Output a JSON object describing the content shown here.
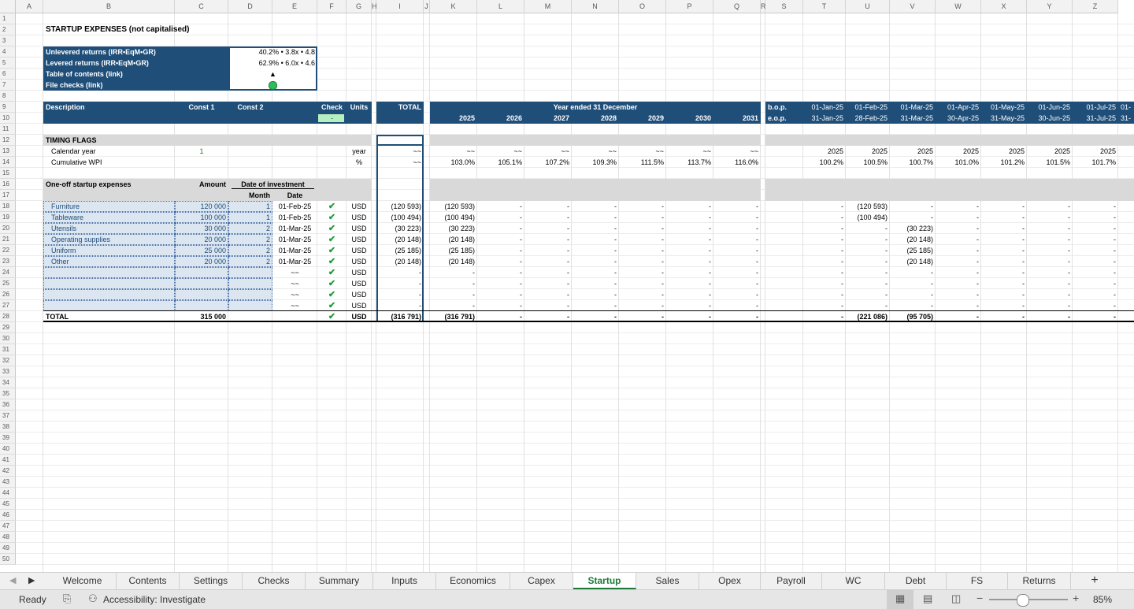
{
  "columns": [
    "A",
    "B",
    "C",
    "D",
    "E",
    "F",
    "G",
    "H",
    "I",
    "J",
    "K",
    "L",
    "M",
    "N",
    "O",
    "P",
    "Q",
    "R",
    "S",
    "T",
    "U",
    "V",
    "W",
    "X",
    "Y",
    "Z"
  ],
  "rows": [
    "1",
    "2",
    "3",
    "4",
    "5",
    "6",
    "7",
    "8",
    "9",
    "10",
    "11",
    "12",
    "13",
    "14",
    "15",
    "16",
    "17",
    "18",
    "19",
    "20",
    "21",
    "22",
    "23",
    "24",
    "25",
    "26",
    "27",
    "28",
    "29",
    "30",
    "31",
    "32",
    "33",
    "34",
    "35",
    "36",
    "37",
    "38",
    "39",
    "40",
    "41",
    "42",
    "43",
    "44",
    "45",
    "46",
    "47",
    "48",
    "49",
    "50"
  ],
  "title": "STARTUP EXPENSES (not capitalised)",
  "summary": {
    "unlevered_label": "Unlevered returns (IRR•EqM•GR)",
    "unlevered_value": "40.2% • 3.8x • 4.8",
    "levered_label": "Levered returns (IRR•EqM•GR)",
    "levered_value": "62.9% • 6.0x • 4.6",
    "toc_label": "Table of contents (link)",
    "toc_value": "▲",
    "checks_label": "File checks (link)"
  },
  "header": {
    "description": "Description",
    "const1": "Const 1",
    "const2": "Const 2",
    "check": "Check",
    "check_value": "-",
    "units": "Units",
    "total": "TOTAL",
    "year_ended": "Year ended 31 December",
    "years": [
      "2025",
      "2026",
      "2027",
      "2028",
      "2029",
      "2030",
      "2031"
    ],
    "bop": "b.o.p.",
    "eop": "e.o.p.",
    "month_starts": [
      "01-Jan-25",
      "01-Feb-25",
      "01-Mar-25",
      "01-Apr-25",
      "01-May-25",
      "01-Jun-25",
      "01-Jul-25",
      "01-"
    ],
    "month_ends": [
      "31-Jan-25",
      "28-Feb-25",
      "31-Mar-25",
      "30-Apr-25",
      "31-May-25",
      "30-Jun-25",
      "31-Jul-25",
      "31-"
    ]
  },
  "timing": {
    "section": "TIMING FLAGS",
    "calendar_label": "Calendar year",
    "calendar_const": "1",
    "calendar_unit": "year",
    "calendar_total": "~~",
    "calendar_annual": [
      "~~",
      "~~",
      "~~",
      "~~",
      "~~",
      "~~",
      "~~"
    ],
    "calendar_monthly": [
      "2025",
      "2025",
      "2025",
      "2025",
      "2025",
      "2025",
      "2025"
    ],
    "wpi_label": "Cumulative WPI",
    "wpi_unit": "%",
    "wpi_total": "~~",
    "wpi_annual": [
      "103.0%",
      "105.1%",
      "107.2%",
      "109.3%",
      "111.5%",
      "113.7%",
      "116.0%"
    ],
    "wpi_monthly": [
      "100.2%",
      "100.5%",
      "100.7%",
      "101.0%",
      "101.2%",
      "101.5%",
      "101.7%"
    ]
  },
  "oneoff": {
    "section": "One-off startup expenses",
    "amount": "Amount",
    "date_of_investment": "Date of investment",
    "month": "Month",
    "date": "Date"
  },
  "items": [
    {
      "name": "Furniture",
      "amount": "120 000",
      "month": "1",
      "date": "01-Feb-25",
      "units": "USD",
      "total": "(120 593)",
      "annual": [
        "(120 593)",
        "-",
        "-",
        "-",
        "-",
        "-",
        "-"
      ],
      "monthly": [
        "-",
        "(120 593)",
        "-",
        "-",
        "-",
        "-",
        "-"
      ]
    },
    {
      "name": "Tableware",
      "amount": "100 000",
      "month": "1",
      "date": "01-Feb-25",
      "units": "USD",
      "total": "(100 494)",
      "annual": [
        "(100 494)",
        "-",
        "-",
        "-",
        "-",
        "-",
        "-"
      ],
      "monthly": [
        "-",
        "(100 494)",
        "-",
        "-",
        "-",
        "-",
        "-"
      ]
    },
    {
      "name": "Utensils",
      "amount": "30 000",
      "month": "2",
      "date": "01-Mar-25",
      "units": "USD",
      "total": "(30 223)",
      "annual": [
        "(30 223)",
        "-",
        "-",
        "-",
        "-",
        "-",
        "-"
      ],
      "monthly": [
        "-",
        "-",
        "(30 223)",
        "-",
        "-",
        "-",
        "-"
      ]
    },
    {
      "name": "Operating supplies",
      "amount": "20 000",
      "month": "2",
      "date": "01-Mar-25",
      "units": "USD",
      "total": "(20 148)",
      "annual": [
        "(20 148)",
        "-",
        "-",
        "-",
        "-",
        "-",
        "-"
      ],
      "monthly": [
        "-",
        "-",
        "(20 148)",
        "-",
        "-",
        "-",
        "-"
      ]
    },
    {
      "name": "Uniform",
      "amount": "25 000",
      "month": "2",
      "date": "01-Mar-25",
      "units": "USD",
      "total": "(25 185)",
      "annual": [
        "(25 185)",
        "-",
        "-",
        "-",
        "-",
        "-",
        "-"
      ],
      "monthly": [
        "-",
        "-",
        "(25 185)",
        "-",
        "-",
        "-",
        "-"
      ]
    },
    {
      "name": "Other",
      "amount": "20 000",
      "month": "2",
      "date": "01-Mar-25",
      "units": "USD",
      "total": "(20 148)",
      "annual": [
        "(20 148)",
        "-",
        "-",
        "-",
        "-",
        "-",
        "-"
      ],
      "monthly": [
        "-",
        "-",
        "(20 148)",
        "-",
        "-",
        "-",
        "-"
      ]
    },
    {
      "name": "",
      "amount": "",
      "month": "",
      "date": "~~",
      "units": "USD",
      "total": "-",
      "annual": [
        "-",
        "-",
        "-",
        "-",
        "-",
        "-",
        "-"
      ],
      "monthly": [
        "-",
        "-",
        "-",
        "-",
        "-",
        "-",
        "-"
      ]
    },
    {
      "name": "",
      "amount": "",
      "month": "",
      "date": "~~",
      "units": "USD",
      "total": "-",
      "annual": [
        "-",
        "-",
        "-",
        "-",
        "-",
        "-",
        "-"
      ],
      "monthly": [
        "-",
        "-",
        "-",
        "-",
        "-",
        "-",
        "-"
      ]
    },
    {
      "name": "",
      "amount": "",
      "month": "",
      "date": "~~",
      "units": "USD",
      "total": "-",
      "annual": [
        "-",
        "-",
        "-",
        "-",
        "-",
        "-",
        "-"
      ],
      "monthly": [
        "-",
        "-",
        "-",
        "-",
        "-",
        "-",
        "-"
      ]
    },
    {
      "name": "",
      "amount": "",
      "month": "",
      "date": "~~",
      "units": "USD",
      "total": "-",
      "annual": [
        "-",
        "-",
        "-",
        "-",
        "-",
        "-",
        "-"
      ],
      "monthly": [
        "-",
        "-",
        "-",
        "-",
        "-",
        "-",
        "-"
      ]
    }
  ],
  "totals": {
    "label": "TOTAL",
    "amount": "315 000",
    "units": "USD",
    "total": "(316 791)",
    "annual": [
      "(316 791)",
      "-",
      "-",
      "-",
      "-",
      "-",
      "-"
    ],
    "monthly": [
      "-",
      "(221 086)",
      "(95 705)",
      "-",
      "-",
      "-",
      "-"
    ]
  },
  "tabs": [
    "Welcome",
    "Contents",
    "Settings",
    "Checks",
    "Summary",
    "Inputs",
    "Economics",
    "Capex",
    "Startup",
    "Sales",
    "Opex",
    "Payroll",
    "WC",
    "Debt",
    "FS",
    "Returns"
  ],
  "active_tab": "Startup",
  "add_sheet": "+",
  "status": {
    "ready": "Ready",
    "accessibility": "Accessibility: Investigate",
    "zoom": "85%"
  },
  "colors": {
    "navy": "#1f4e79",
    "input_blue": "#dce6f1",
    "accent_green": "#1d7a3a",
    "check_green": "#1f9a3a"
  }
}
